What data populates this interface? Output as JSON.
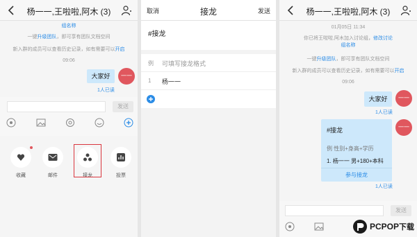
{
  "panel1": {
    "title": "杨一一,王啦啦,阿木 (3)",
    "group_name_link": "组名称",
    "upgrade_pre": "一键",
    "upgrade_link": "升级团队",
    "upgrade_post": "，即可享有团队文档空间",
    "history_text": "新入群的成员可以查看历史记录，如有需要可以",
    "history_link": "开启",
    "time": "09:06",
    "message": "大家好",
    "read_status": "1人已读",
    "avatar_text": "一一",
    "send_label": "发送",
    "apps": [
      {
        "label": "收藏",
        "icon": "heart-icon"
      },
      {
        "label": "邮件",
        "icon": "mail-icon"
      },
      {
        "label": "接龙",
        "icon": "relay-icon"
      },
      {
        "label": "投票",
        "icon": "vote-icon"
      }
    ]
  },
  "panel2": {
    "cancel": "取消",
    "title": "接龙",
    "send": "发送",
    "content": "#接龙",
    "example_idx": "例",
    "example_placeholder": "可填写接龙格式",
    "first_idx": "1",
    "first_value": "杨一一"
  },
  "panel3": {
    "title": "杨一一,王啦啦,阿木 (3)",
    "date": "01月05日 11:34",
    "invite_text": "你已将王啦啦,阿木加入讨论组，",
    "invite_link": "修改讨论",
    "group_name_link": "组名称",
    "upgrade_pre": "一键",
    "upgrade_link": "升级团队",
    "upgrade_post": "，即可享有团队文档空间",
    "history_text": "新入群的成员可以查看历史记录，如有需要可以",
    "history_link": "开启",
    "time": "09:06",
    "message": "大家好",
    "read_status_1": "1人已读",
    "avatar_text": "一一",
    "relay_title": "#接龙",
    "relay_example": "例 性别+身高+学历",
    "relay_entry": "1. 杨一一 男+180+本科",
    "relay_join": "参与接龙",
    "read_status_2": "1人已读",
    "send_label": "发送"
  },
  "watermark": {
    "brand": "PCPOP",
    "suffix": "下载"
  }
}
